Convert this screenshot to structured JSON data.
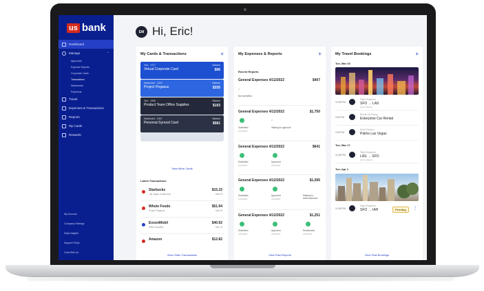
{
  "brand": {
    "logo_us": "us",
    "logo_bank": "bank"
  },
  "greeting": {
    "initials": "EM",
    "text": "Hi, Eric!"
  },
  "sidebar": {
    "items": [
      {
        "label": "Dashboard",
        "icon": "dashboard-icon",
        "active": true
      },
      {
        "label": "Manage",
        "icon": "manage-icon",
        "active": false
      }
    ],
    "sub_items": [
      "Approvals",
      "Expense Reports",
      "Corporate Cards",
      "Transactions",
      "Statements",
      "Payments"
    ],
    "items2": [
      {
        "label": "Travel",
        "icon": "plane-icon"
      },
      {
        "label": "Expenses & Transactions",
        "icon": "dollar-icon"
      },
      {
        "label": "Reports",
        "icon": "report-icon"
      },
      {
        "label": "My Cards",
        "icon": "card-icon"
      },
      {
        "label": "Rewards",
        "icon": "gift-icon"
      }
    ],
    "bottom": [
      "My Account",
      "Company Settings",
      "Data Insights",
      "Support FAQs",
      "Chat With Us"
    ]
  },
  "cards_panel": {
    "title": "My Cards & Transactions",
    "cards": [
      {
        "label": "Visa ...3727",
        "name": "Virtual Corporate Card",
        "balance_label": "Balance",
        "balance": "$96",
        "color": "#1d4fd1"
      },
      {
        "label": "Mastercard ...1820",
        "name": "Project Pegasus",
        "balance_label": "Balance",
        "balance": "$335",
        "color": "#2d66e0"
      },
      {
        "label": "Visa ...2958",
        "name": "Product Team Office Supplies",
        "balance_label": "Balance",
        "balance": "$193",
        "color": "#23283a"
      },
      {
        "label": "Mastercard ...6367",
        "name": "Personal Synced Card",
        "balance_label": "Balance",
        "balance": "$581",
        "color": "#2c3245"
      }
    ],
    "view_more": "View More Cards",
    "tx_title": "Latest Transactions",
    "transactions": [
      {
        "name": "Starbucks",
        "sub": "Las Vegas Conference",
        "amount": "$15.15",
        "date": "Mar 09",
        "color": "#d52b1e"
      },
      {
        "name": "Whole Foods",
        "sub": "Project Pegasus",
        "amount": "$51.94",
        "date": "Mar 09",
        "color": "#d52b1e"
      },
      {
        "name": "ExxonMobil",
        "sub": "Office Supplies",
        "amount": "$40.92",
        "date": "Mar 10",
        "color": "#2540c6"
      },
      {
        "name": "Amazon",
        "sub": "",
        "amount": "$12.82",
        "date": "",
        "color": "#d52b1e"
      }
    ],
    "footer": "View Older Transactions"
  },
  "expenses_panel": {
    "title": "My Expenses & Reports",
    "recent_title": "Recent Reports",
    "reports": [
      {
        "name": "General Expenses 4/12/2022",
        "amount": "$407",
        "status": "Not submitted"
      },
      {
        "name": "General Expenses 4/12/2022",
        "amount": "$1,750",
        "s1": "Submitted",
        "s1date": "4/12/2022",
        "s2": "Waiting for approval"
      },
      {
        "name": "General Expenses 4/12/2022",
        "amount": "$641",
        "s1": "Submitted",
        "s1date": "4/12/2022",
        "s2": "Approved",
        "s2date": "4/12/2022"
      },
      {
        "name": "General Expenses 4/12/2022",
        "amount": "$1,595",
        "s1": "Submitted",
        "s1date": "4/12/2022",
        "s2": "Approved",
        "s2date": "4/12/2022",
        "s3": "Waiting for reimbursement"
      },
      {
        "name": "General Expenses 4/12/2022",
        "amount": "$1,251",
        "s1": "Submitted",
        "s1date": "4/12/2022",
        "s2": "Approved",
        "s2date": "4/12/2022",
        "s3": "Reimbursed",
        "s3date": "4/12/2022"
      }
    ],
    "footer": "View Past Reports"
  },
  "travel_panel": {
    "title": "My Travel Bookings",
    "day1": "Tue, Mar 15",
    "day2": "Tue, Mar 17",
    "day3": "Tue, Apr 1",
    "trips": [
      {
        "time": "12:35 PM",
        "label": "Flight Departure",
        "main": "SFO → LAS",
        "sub": "AA & UAlines"
      },
      {
        "time": "3:00 PM",
        "label": "Rental Car Pickup",
        "main": "Enterprise Car Rental",
        "sub": ""
      },
      {
        "time": "4:00 PM",
        "label": "Hotel Check-in",
        "main": "Palms Las Vegas",
        "sub": ""
      },
      {
        "time": "12:35 PM",
        "label": "Flight Departure",
        "main": "LAS → SFO",
        "sub": "AA & UAlines"
      },
      {
        "time": "12:35 PM",
        "label": "Flight Departure",
        "main": "SFO → IAH",
        "sub": ""
      }
    ],
    "pending": "Pending",
    "footer": "View Past Bookings"
  }
}
